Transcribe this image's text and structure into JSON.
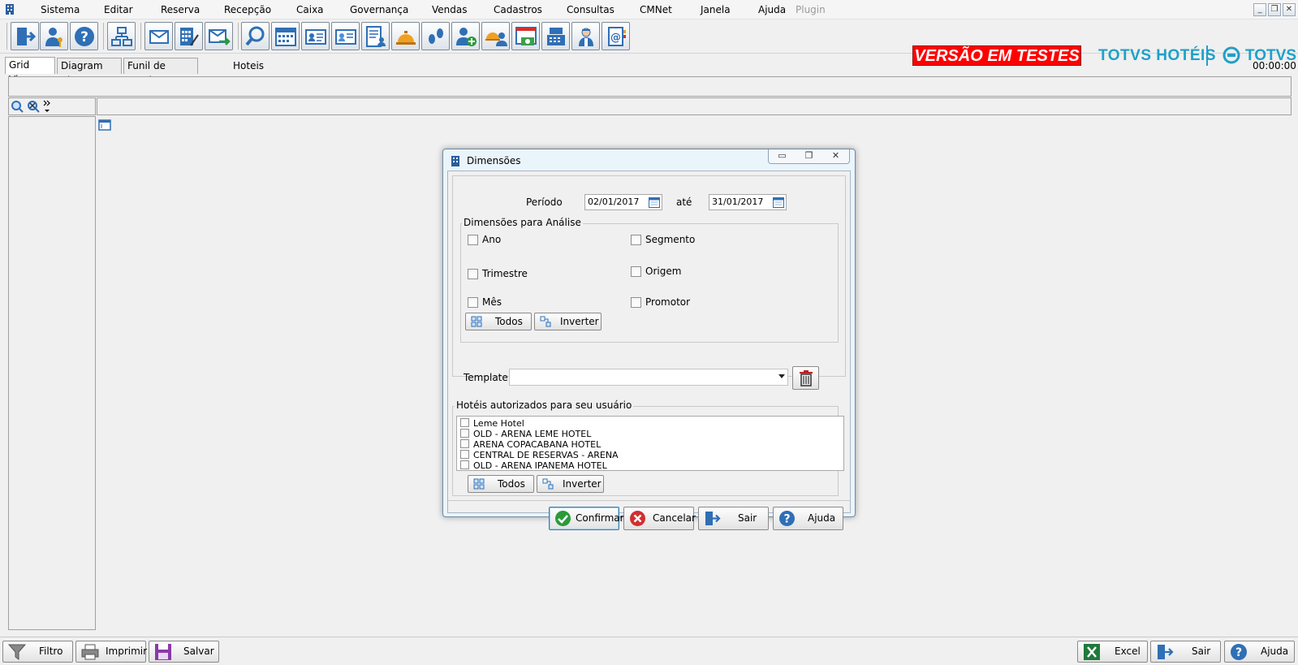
{
  "menu": [
    "Sistema",
    "Editar",
    "Reserva",
    "Recepção",
    "Caixa",
    "Governança",
    "Vendas",
    "Cadastros",
    "Consultas",
    "CMNet",
    "Janela",
    "Ajuda",
    "Plugin"
  ],
  "window_controls": {
    "minimize": "_",
    "restore": "❐",
    "close": "✕"
  },
  "brand": {
    "banner": "VERSÃO EM TESTES",
    "hoteis": "TOTVS HOTÉIS",
    "totvs": "TOTVS"
  },
  "tabs": [
    "Grid View",
    "Diagram View",
    "Funil de Vendas"
  ],
  "hoteis_label": "Hoteis",
  "timer": "00:00:00",
  "dialog": {
    "title": "Dimensões",
    "periodo_label": "Período",
    "date_from": "02/01/2017",
    "ate_label": "até",
    "date_to": "31/01/2017",
    "dimensoes_title": "Dimensões para Análise",
    "dims": {
      "ano": "Ano",
      "trimestre": "Trimestre",
      "mes": "Mês",
      "segmento": "Segmento",
      "origem": "Origem",
      "promotor": "Promotor"
    },
    "todos": "Todos",
    "inverter": "Inverter",
    "template_label": "Template",
    "template_value": "",
    "hoteis_title": "Hotéis autorizados para seu usuário",
    "hotels": [
      "Leme Hotel",
      "OLD - ARENA LEME HOTEL",
      "ARENA COPACABANA HOTEL",
      "CENTRAL DE RESERVAS - ARENA",
      "OLD - ARENA IPANEMA HOTEL"
    ],
    "buttons": {
      "confirmar": "Confirmar",
      "cancelar": "Cancelar",
      "sair": "Sair",
      "ajuda": "Ajuda"
    }
  },
  "statusbar": {
    "filtro": "Filtro",
    "imprimir": "Imprimir",
    "salvar": "Salvar",
    "excel": "Excel",
    "sair": "Sair",
    "ajuda": "Ajuda"
  },
  "colors": {
    "banner_bg": "#ff0000",
    "brand": "#1fa0c8"
  }
}
